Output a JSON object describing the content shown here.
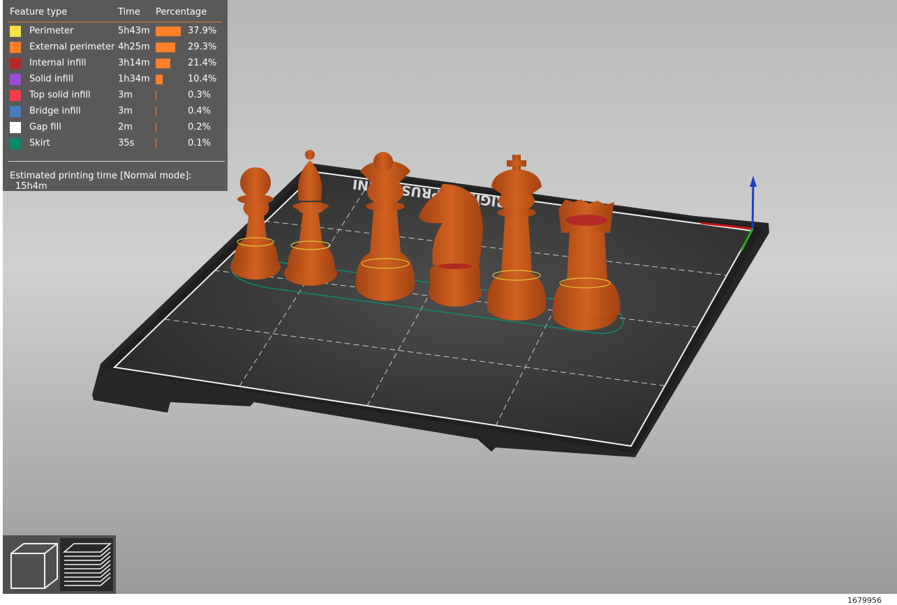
{
  "legend": {
    "header": {
      "feature_type": "Feature type",
      "time": "Time",
      "percentage": "Percentage"
    },
    "rows": [
      {
        "label": "Perimeter",
        "time": "5h43m",
        "percent": "37.9%",
        "fraction": 0.379,
        "color": "#f7e24a"
      },
      {
        "label": "External perimeter",
        "time": "4h25m",
        "percent": "29.3%",
        "fraction": 0.293,
        "color": "#ff7f2a"
      },
      {
        "label": "Internal infill",
        "time": "3h14m",
        "percent": "21.4%",
        "fraction": 0.214,
        "color": "#b22a25"
      },
      {
        "label": "Solid infill",
        "time": "1h34m",
        "percent": "10.4%",
        "fraction": 0.104,
        "color": "#9b4fd6"
      },
      {
        "label": "Top solid infill",
        "time": "3m",
        "percent": "0.3%",
        "fraction": 0.003,
        "color": "#f0404a"
      },
      {
        "label": "Bridge infill",
        "time": "3m",
        "percent": "0.4%",
        "fraction": 0.004,
        "color": "#4c7fc0"
      },
      {
        "label": "Gap fill",
        "time": "2m",
        "percent": "0.2%",
        "fraction": 0.002,
        "color": "#ffffff"
      },
      {
        "label": "Skirt",
        "time": "35s",
        "percent": "0.1%",
        "fraction": 0.001,
        "color": "#0d8a6a"
      }
    ],
    "estimate": {
      "label": "Estimated printing time [Normal mode]:",
      "value": "15h4m"
    }
  },
  "scene": {
    "bed_label": "ORIGINAL PRUSA MINI",
    "pieces": [
      "pawn",
      "bishop",
      "queen",
      "knight",
      "king",
      "rook"
    ],
    "piece_color": "#c8561c"
  },
  "toolbar": {
    "items": [
      {
        "name": "3d-editor-view",
        "icon": "cube-icon",
        "active": false
      },
      {
        "name": "preview-view",
        "icon": "layers-icon",
        "active": true
      }
    ]
  },
  "footer": {
    "text": "1679956"
  }
}
